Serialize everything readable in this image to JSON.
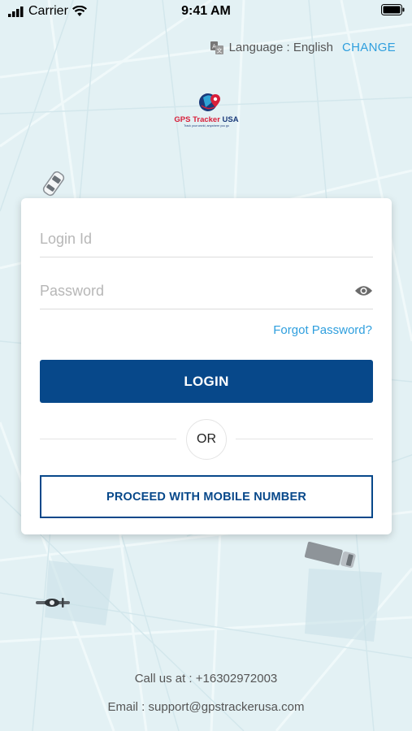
{
  "status_bar": {
    "carrier": "Carrier",
    "time": "9:41 AM"
  },
  "language": {
    "label": "Language : English",
    "change": "CHANGE"
  },
  "logo": {
    "brand": "GPS Tracker USA",
    "tagline": "Track your world, anywhere you go"
  },
  "form": {
    "login_placeholder": "Login Id",
    "password_placeholder": "Password",
    "forgot": "Forgot Password?",
    "login_button": "LOGIN",
    "or": "OR",
    "mobile_button": "PROCEED WITH MOBILE NUMBER"
  },
  "footer": {
    "call": "Call us at : +16302972003",
    "email": "Email : support@gpstrackerusa.com"
  },
  "colors": {
    "primary": "#07488a",
    "link": "#2f9fde",
    "background": "#e3f1f4"
  }
}
